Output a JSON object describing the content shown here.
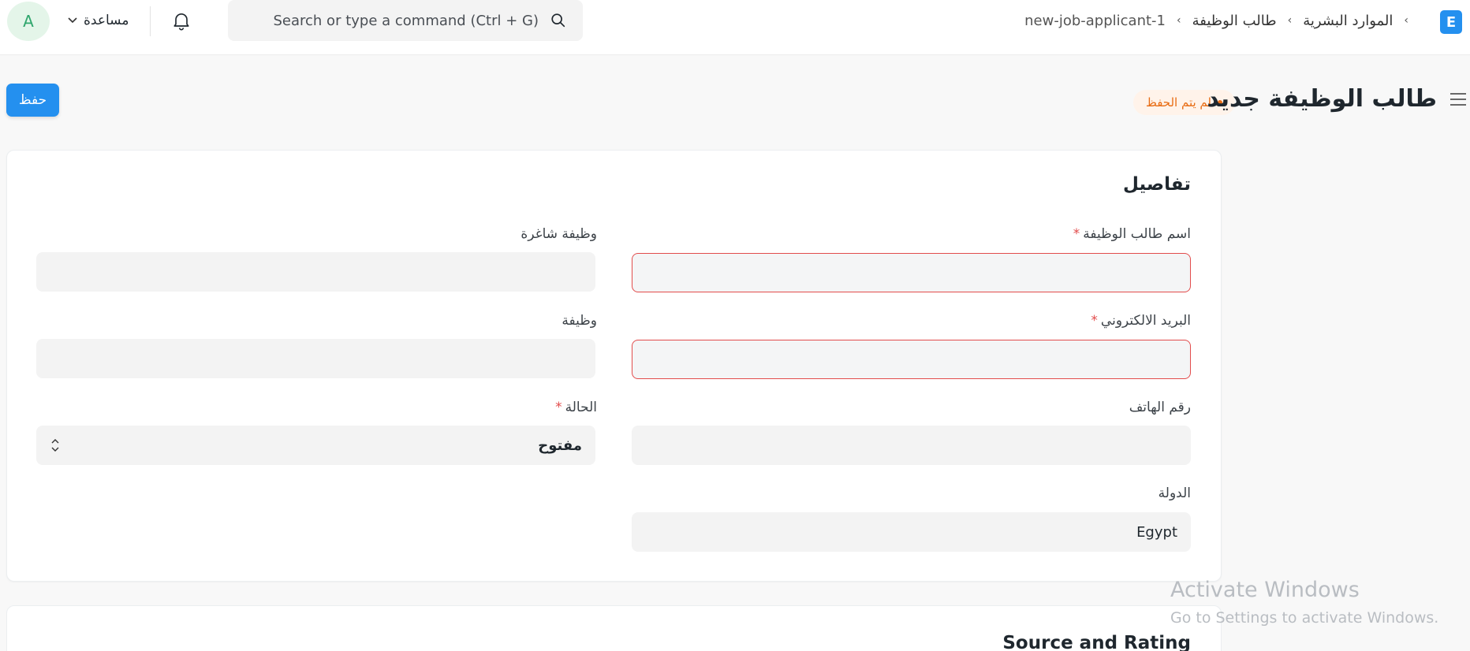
{
  "navbar": {
    "avatar_initial": "A",
    "help_label": "مساعدة",
    "search_placeholder": "Search or type a command (Ctrl + G)",
    "breadcrumb": [
      "الموارد البشرية",
      "طالب الوظيفة",
      "new-job-applicant-1"
    ],
    "app_logo": "E"
  },
  "page": {
    "title": "طالب الوظيفة جديد",
    "status": "لم يتم الحفظ",
    "save_label": "حفظ"
  },
  "form": {
    "section_title": "تفاصيل",
    "fields": {
      "applicant_name": {
        "label": "اسم طالب الوظيفة",
        "value": ""
      },
      "email": {
        "label": "البريد الالكتروني",
        "value": ""
      },
      "phone": {
        "label": "رقم الهاتف",
        "value": ""
      },
      "country": {
        "label": "الدولة",
        "value": "Egypt"
      },
      "job_opening": {
        "label": "وظيفة شاغرة",
        "value": ""
      },
      "designation": {
        "label": "وظيفة",
        "value": ""
      },
      "status": {
        "label": "الحالة",
        "value": "مفتوح"
      }
    },
    "required_marker": "*"
  },
  "section2": {
    "title": "Source and Rating"
  },
  "watermark": {
    "line1": "Activate Windows",
    "line2": "Go to Settings to activate Windows."
  },
  "colors": {
    "primary": "#2490ef",
    "error_border": "#e24c4c",
    "status_orange": "#e86c13",
    "avatar_green": "#30a66d"
  }
}
